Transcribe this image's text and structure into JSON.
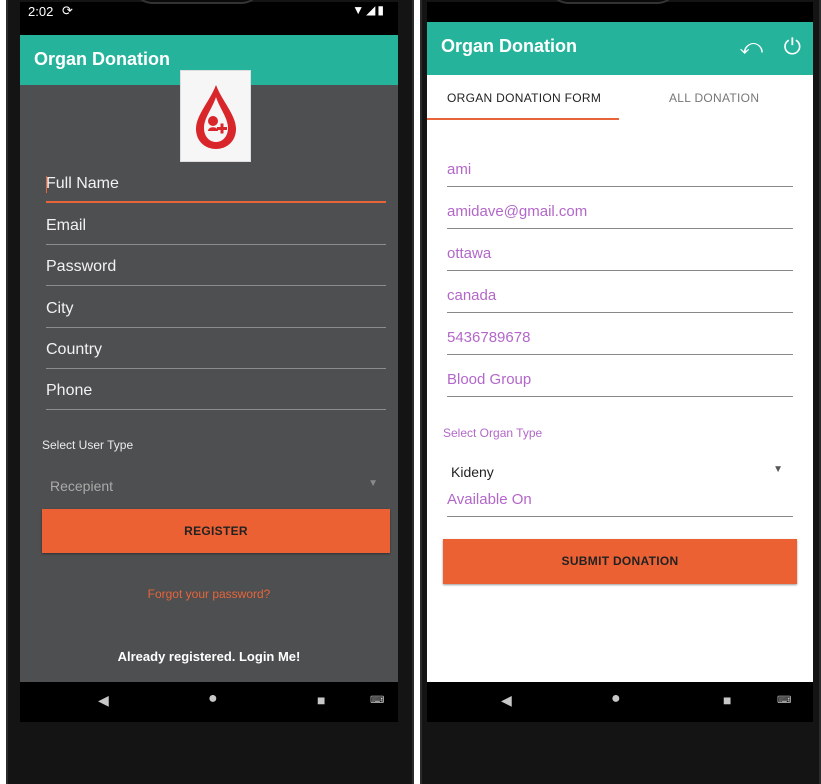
{
  "left_screen": {
    "status": {
      "time": "2:02",
      "sync_icon": "sync-icon",
      "right_icons": "wifi-icon signal-icon battery-icon"
    },
    "app_title": "Organ Donation",
    "logo_icon": "blood-drop-logo-icon",
    "fields": [
      {
        "placeholder": "Full Name"
      },
      {
        "placeholder": "Email"
      },
      {
        "placeholder": "Password"
      },
      {
        "placeholder": "City"
      },
      {
        "placeholder": "Country"
      },
      {
        "placeholder": "Phone"
      }
    ],
    "user_type_label": "Select User Type",
    "user_type_selected": "Recepient",
    "register_label": "REGISTER",
    "forgot_link": "Forgot your password?",
    "login_link": "Already registered. Login Me!",
    "colors": {
      "appbar": "#26b39c",
      "background": "#4d4f50",
      "accent": "#ec6134"
    }
  },
  "right_screen": {
    "app_title": "Organ Donation",
    "actions": {
      "back_icon": "undo-icon",
      "power_icon": "power-icon"
    },
    "tabs": [
      {
        "label": "ORGAN DONATION FORM",
        "selected": true
      },
      {
        "label": "ALL DONATION",
        "selected": false
      }
    ],
    "fields": [
      {
        "value": "ami"
      },
      {
        "value": "amidave@gmail.com"
      },
      {
        "value": "ottawa"
      },
      {
        "value": "canada"
      },
      {
        "value": "5436789678"
      },
      {
        "value": "Blood Group"
      }
    ],
    "organ_type_label": "Select Organ Type",
    "organ_type_selected": "Kideny",
    "available_on": "Available On",
    "submit_label": "SUBMIT DONATION",
    "colors": {
      "appbar": "#26b39c",
      "field_text": "#b367c9",
      "accent": "#ec6134"
    }
  },
  "navigation": {
    "back": "back-icon",
    "home": "home-icon",
    "recents": "recents-icon",
    "keyboard": "keyboard-icon"
  }
}
